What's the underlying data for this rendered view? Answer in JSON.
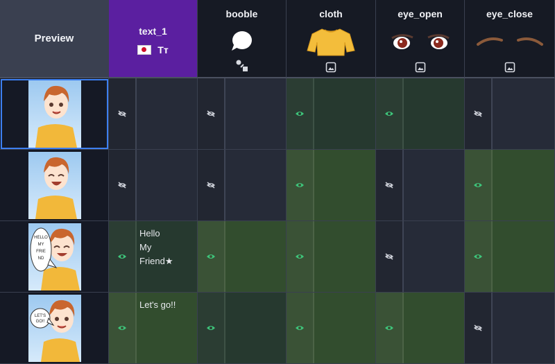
{
  "header": {
    "preview_label": "Preview",
    "columns": [
      {
        "name": "text_1",
        "kind": "text",
        "selected": true
      },
      {
        "name": "booble",
        "kind": "shape"
      },
      {
        "name": "cloth",
        "kind": "image"
      },
      {
        "name": "eye_open",
        "kind": "image"
      },
      {
        "name": "eye_close",
        "kind": "image"
      }
    ]
  },
  "rows": [
    {
      "preview": "smile-open-eyes",
      "cells": [
        {
          "visible": false,
          "text": ""
        },
        {
          "visible": false
        },
        {
          "visible": true
        },
        {
          "visible": true
        },
        {
          "visible": false
        }
      ]
    },
    {
      "preview": "smile-closed-eyes",
      "cells": [
        {
          "visible": false,
          "text": ""
        },
        {
          "visible": false
        },
        {
          "visible": true
        },
        {
          "visible": false
        },
        {
          "visible": true
        }
      ]
    },
    {
      "preview": "speech-bubble-closed-eyes",
      "cells": [
        {
          "visible": true,
          "text": "Hello\nMy\nFriend★"
        },
        {
          "visible": true
        },
        {
          "visible": true
        },
        {
          "visible": false
        },
        {
          "visible": true
        }
      ]
    },
    {
      "preview": "speech-bubble-open-eyes",
      "cells": [
        {
          "visible": true,
          "text": "Let's go!!"
        },
        {
          "visible": true
        },
        {
          "visible": true
        },
        {
          "visible": true
        },
        {
          "visible": false
        }
      ]
    }
  ],
  "colors": {
    "accent": "#3d7ff0",
    "text_header": "#5b1fa0",
    "visible_green": "#3ec47a",
    "on_bg": "#324d2e"
  }
}
